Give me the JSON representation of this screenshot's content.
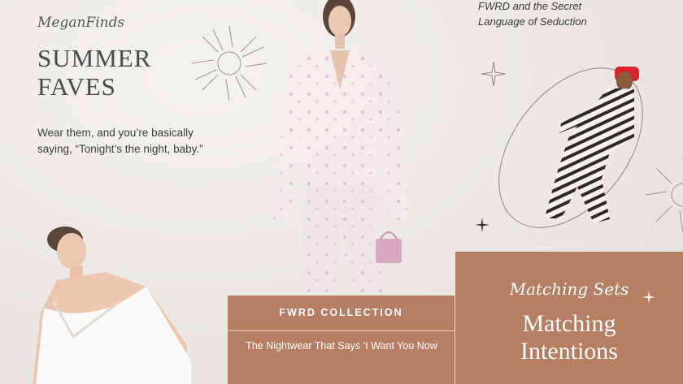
{
  "brand": "MeganFinds",
  "headline": [
    "SUMMER",
    "FAVES"
  ],
  "body_text": "Wear them, and you’re basically saying, “Tonight’s the night, baby.”",
  "top_right_text": [
    "FWRD and the Secret",
    "Language of Seduction"
  ],
  "collection_box": {
    "title": "FWRD COLLECTION",
    "subtitle": "The Nightwear That Says ‘I Want You Now"
  },
  "matching_box": {
    "script": "Matching Sets",
    "title": [
      "Matching",
      "Intentions"
    ]
  },
  "colors": {
    "background": "#eeebe7",
    "accent_box": "#b67e62",
    "text_dark": "#3d3d3d"
  },
  "icons": [
    "sun-icon",
    "sparkle-icon"
  ]
}
